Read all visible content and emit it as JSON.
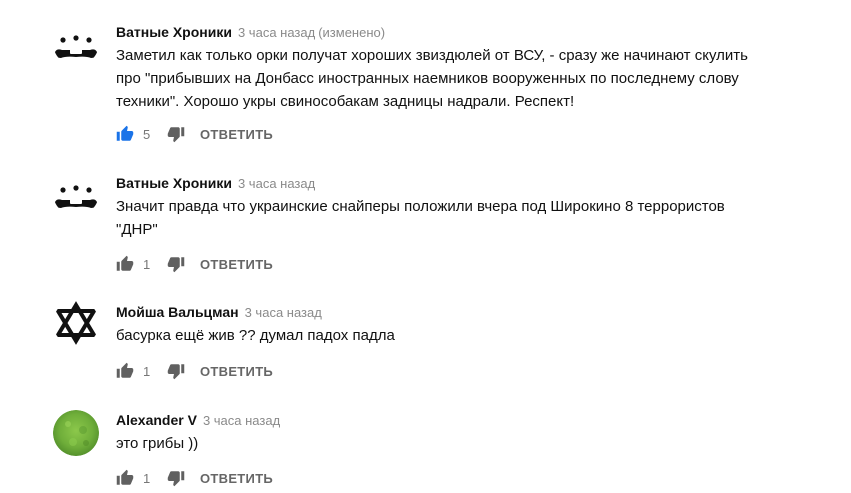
{
  "comments": [
    {
      "author": "Ватные Хроники",
      "time": "3 часа назад",
      "edited": "(изменено)",
      "avatar_icon": "panda-face-icon",
      "text_lines": [
        "Заметил как только орки получат хороших звиздюлей от ВСУ, - сразу же начинают скулить",
        "про \"прибывших на Донбасс иностранных наемников вооруженных по последнему слову",
        "техники\". Хорошо укры свинособакам задницы надрали. Респект!"
      ],
      "likes": "5",
      "liked": true,
      "reply_label": "ОТВЕТИТЬ"
    },
    {
      "author": "Ватные Хроники",
      "time": "3 часа назад",
      "avatar_icon": "panda-face-icon",
      "text_lines": [
        "Значит правда что украинские снайперы положили вчера под Широкино 8 террористов",
        "\"ДНР\""
      ],
      "likes": "1",
      "liked": false,
      "reply_label": "ОТВЕТИТЬ"
    },
    {
      "author": "Мойша Вальцман",
      "time": "3 часа назад",
      "avatar_icon": "star-of-david-icon",
      "text_lines": [
        "басурка ещё жив ?? думал падох падла"
      ],
      "likes": "1",
      "liked": false,
      "reply_label": "ОТВЕТИТЬ"
    },
    {
      "author": "Alexander V",
      "time": "3 часа назад",
      "avatar_icon": "green-grass-avatar-icon",
      "text_lines": [
        "это грибы ))"
      ],
      "likes": "1",
      "liked": false,
      "reply_label": "ОТВЕТИТЬ"
    }
  ],
  "colors": {
    "like_active": "#1a73e8",
    "icon_inactive": "#606060",
    "meta_gray": "#8a8a8a",
    "avatar_grass": "#6fae3a"
  }
}
